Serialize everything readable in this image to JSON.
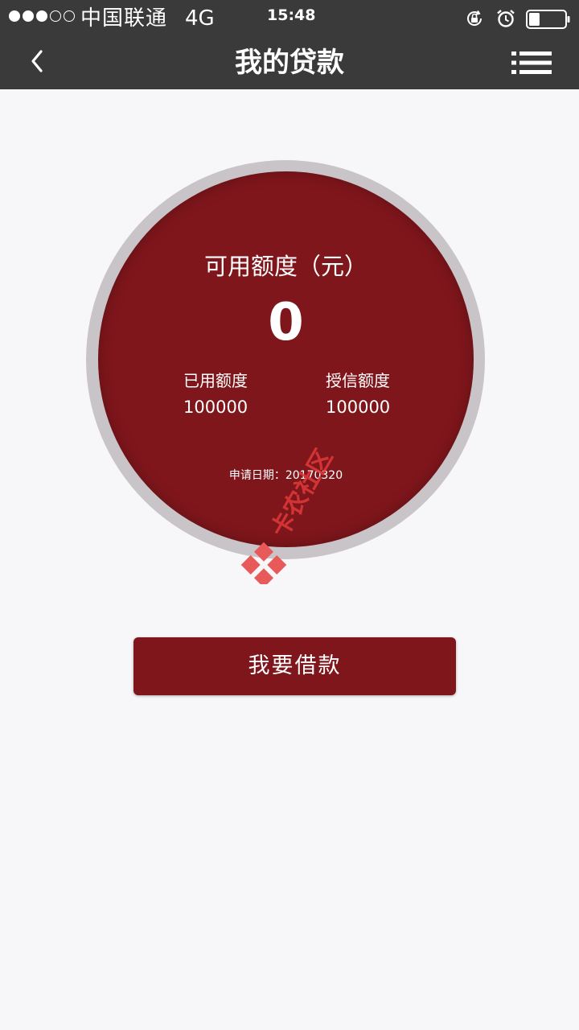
{
  "status_bar": {
    "carrier": "中国联通",
    "network": "4G",
    "time": "15:48",
    "signal_bars_filled": 3,
    "signal_bars_total": 5,
    "battery_level": 0.3
  },
  "header": {
    "title": "我的贷款",
    "back_icon": "chevron-left-icon",
    "menu_icon": "list-menu-icon"
  },
  "credit": {
    "available_label": "可用额度（元）",
    "available_value": "0",
    "used_label": "已用额度",
    "used_value": "100000",
    "limit_label": "授信额度",
    "limit_value": "100000",
    "apply_date": "申请日期：20170320"
  },
  "watermark": {
    "text": "卡农社区"
  },
  "actions": {
    "borrow_label": "我要借款"
  },
  "colors": {
    "header_bg": "#3a3a3a",
    "accent": "#7f161c",
    "ring": "#c9c4c8",
    "page_bg": "#f7f7f9"
  }
}
